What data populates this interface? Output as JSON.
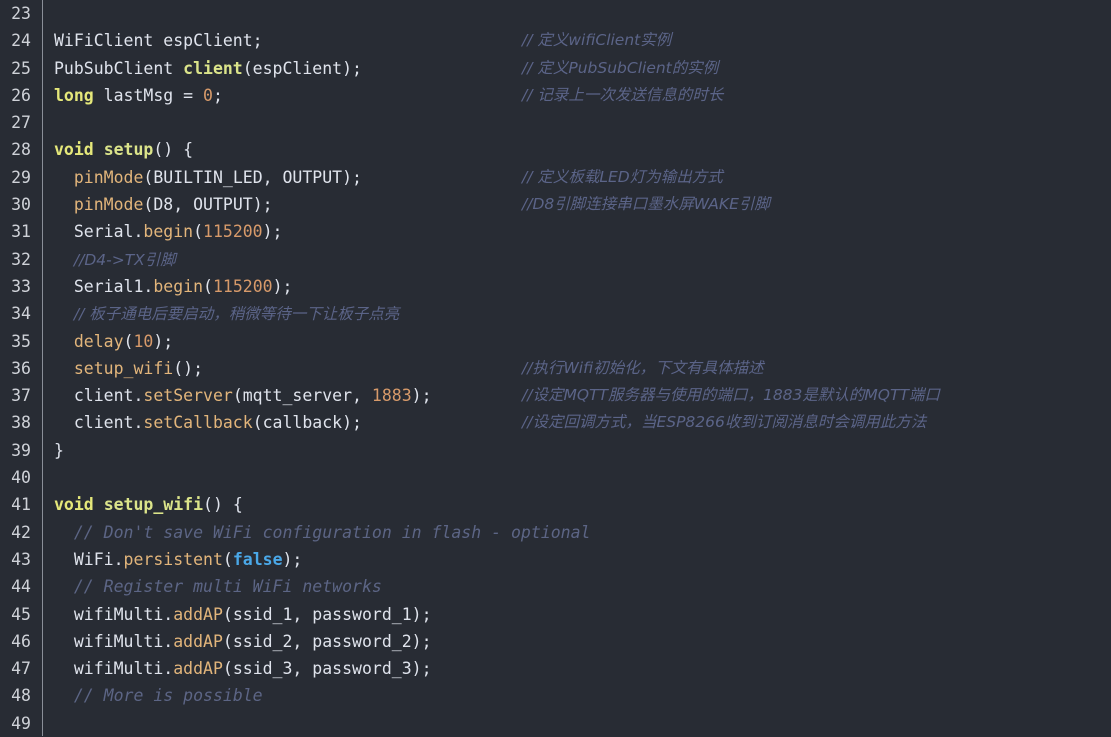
{
  "editor": {
    "theme_name": "one-dark",
    "language": "arduino-cpp",
    "colors": {
      "background": "#282c34",
      "gutter_text": "#cfd2d8",
      "gutter_rule": "#8a8f98",
      "foreground": "#dfe3ec",
      "keyword": "#e5e87a",
      "function": "#dbe48a",
      "method": "#e2b57b",
      "number": "#d79a6a",
      "boolean": "#4aa8e8",
      "comment": "#5c6585"
    },
    "first_line": 23,
    "last_line": 49
  },
  "lines": [
    {
      "no": "23",
      "code": [],
      "tail": null
    },
    {
      "no": "24",
      "code": [
        {
          "cls": "t-plain",
          "text": "WiFiClient espClient;"
        }
      ],
      "tail": {
        "cls": "comment-cn",
        "text": "// 定义wifiClient实例"
      }
    },
    {
      "no": "25",
      "code": [
        {
          "cls": "t-plain",
          "text": "PubSubClient "
        },
        {
          "cls": "t-fnname",
          "text": "client"
        },
        {
          "cls": "t-plain",
          "text": "(espClient);"
        }
      ],
      "tail": {
        "cls": "comment-cn",
        "text": "// 定义PubSubClient的实例"
      }
    },
    {
      "no": "26",
      "code": [
        {
          "cls": "t-kw",
          "text": "long"
        },
        {
          "cls": "t-plain",
          "text": " lastMsg = "
        },
        {
          "cls": "t-num",
          "text": "0"
        },
        {
          "cls": "t-plain",
          "text": ";"
        }
      ],
      "tail": {
        "cls": "comment-cn",
        "text": "// 记录上一次发送信息的时长"
      }
    },
    {
      "no": "27",
      "code": [],
      "tail": null
    },
    {
      "no": "28",
      "code": [
        {
          "cls": "t-kw",
          "text": "void"
        },
        {
          "cls": "t-plain",
          "text": " "
        },
        {
          "cls": "t-fnname",
          "text": "setup"
        },
        {
          "cls": "t-plain",
          "text": "() {"
        }
      ],
      "tail": null
    },
    {
      "no": "29",
      "code": [
        {
          "cls": "t-plain",
          "text": "  "
        },
        {
          "cls": "t-method",
          "text": "pinMode"
        },
        {
          "cls": "t-plain",
          "text": "(BUILTIN_LED, OUTPUT);"
        }
      ],
      "tail": {
        "cls": "comment-cn",
        "text": "// 定义板载LED灯为输出方式"
      }
    },
    {
      "no": "30",
      "code": [
        {
          "cls": "t-plain",
          "text": "  "
        },
        {
          "cls": "t-method",
          "text": "pinMode"
        },
        {
          "cls": "t-plain",
          "text": "(D8, OUTPUT);"
        }
      ],
      "tail": {
        "cls": "comment-cn",
        "text": "//D8引脚连接串口墨水屏WAKE引脚"
      }
    },
    {
      "no": "31",
      "code": [
        {
          "cls": "t-plain",
          "text": "  Serial."
        },
        {
          "cls": "t-method",
          "text": "begin"
        },
        {
          "cls": "t-plain",
          "text": "("
        },
        {
          "cls": "t-num",
          "text": "115200"
        },
        {
          "cls": "t-plain",
          "text": ");"
        }
      ],
      "tail": null
    },
    {
      "no": "32",
      "code": [
        {
          "cls": "t-plain",
          "text": "  "
        },
        {
          "cls": "comment-cn",
          "text": "//D4->TX引脚"
        }
      ],
      "tail": null
    },
    {
      "no": "33",
      "code": [
        {
          "cls": "t-plain",
          "text": "  Serial1."
        },
        {
          "cls": "t-method",
          "text": "begin"
        },
        {
          "cls": "t-plain",
          "text": "("
        },
        {
          "cls": "t-num",
          "text": "115200"
        },
        {
          "cls": "t-plain",
          "text": ");"
        }
      ],
      "tail": null
    },
    {
      "no": "34",
      "code": [
        {
          "cls": "t-plain",
          "text": "  "
        },
        {
          "cls": "comment-cn",
          "text": "// 板子通电后要启动，稍微等待一下让板子点亮"
        }
      ],
      "tail": null
    },
    {
      "no": "35",
      "code": [
        {
          "cls": "t-plain",
          "text": "  "
        },
        {
          "cls": "t-method",
          "text": "delay"
        },
        {
          "cls": "t-plain",
          "text": "("
        },
        {
          "cls": "t-num",
          "text": "10"
        },
        {
          "cls": "t-plain",
          "text": ");"
        }
      ],
      "tail": null
    },
    {
      "no": "36",
      "code": [
        {
          "cls": "t-plain",
          "text": "  "
        },
        {
          "cls": "t-method",
          "text": "setup_wifi"
        },
        {
          "cls": "t-plain",
          "text": "();"
        }
      ],
      "tail": {
        "cls": "comment-cn",
        "text": "//执行Wifi初始化，下文有具体描述"
      }
    },
    {
      "no": "37",
      "code": [
        {
          "cls": "t-plain",
          "text": "  client."
        },
        {
          "cls": "t-method",
          "text": "setServer"
        },
        {
          "cls": "t-plain",
          "text": "(mqtt_server, "
        },
        {
          "cls": "t-num",
          "text": "1883"
        },
        {
          "cls": "t-plain",
          "text": ");"
        }
      ],
      "tail": {
        "cls": "comment-cn",
        "text": "//设定MQTT服务器与使用的端口，1883是默认的MQTT端口"
      }
    },
    {
      "no": "38",
      "code": [
        {
          "cls": "t-plain",
          "text": "  client."
        },
        {
          "cls": "t-method",
          "text": "setCallback"
        },
        {
          "cls": "t-plain",
          "text": "(callback);"
        }
      ],
      "tail": {
        "cls": "comment-cn",
        "text": "//设定回调方式，当ESP8266收到订阅消息时会调用此方法"
      }
    },
    {
      "no": "39",
      "code": [
        {
          "cls": "t-plain",
          "text": "}"
        }
      ],
      "tail": null
    },
    {
      "no": "40",
      "code": [],
      "tail": null
    },
    {
      "no": "41",
      "code": [
        {
          "cls": "t-kw",
          "text": "void"
        },
        {
          "cls": "t-plain",
          "text": " "
        },
        {
          "cls": "t-fnname",
          "text": "setup_wifi"
        },
        {
          "cls": "t-plain",
          "text": "() {"
        }
      ],
      "tail": null
    },
    {
      "no": "42",
      "code": [
        {
          "cls": "t-plain",
          "text": "  "
        },
        {
          "cls": "comment",
          "text": "// Don't save WiFi configuration in flash - optional"
        }
      ],
      "tail": null
    },
    {
      "no": "43",
      "code": [
        {
          "cls": "t-plain",
          "text": "  WiFi."
        },
        {
          "cls": "t-method",
          "text": "persistent"
        },
        {
          "cls": "t-plain",
          "text": "("
        },
        {
          "cls": "t-bool",
          "text": "false"
        },
        {
          "cls": "t-plain",
          "text": ");"
        }
      ],
      "tail": null
    },
    {
      "no": "44",
      "code": [
        {
          "cls": "t-plain",
          "text": "  "
        },
        {
          "cls": "comment",
          "text": "// Register multi WiFi networks"
        }
      ],
      "tail": null
    },
    {
      "no": "45",
      "code": [
        {
          "cls": "t-plain",
          "text": "  wifiMulti."
        },
        {
          "cls": "t-method",
          "text": "addAP"
        },
        {
          "cls": "t-plain",
          "text": "(ssid_1, password_1);"
        }
      ],
      "tail": null
    },
    {
      "no": "46",
      "code": [
        {
          "cls": "t-plain",
          "text": "  wifiMulti."
        },
        {
          "cls": "t-method",
          "text": "addAP"
        },
        {
          "cls": "t-plain",
          "text": "(ssid_2, password_2);"
        }
      ],
      "tail": null
    },
    {
      "no": "47",
      "code": [
        {
          "cls": "t-plain",
          "text": "  wifiMulti."
        },
        {
          "cls": "t-method",
          "text": "addAP"
        },
        {
          "cls": "t-plain",
          "text": "(ssid_3, password_3);"
        }
      ],
      "tail": null
    },
    {
      "no": "48",
      "code": [
        {
          "cls": "t-plain",
          "text": "  "
        },
        {
          "cls": "comment",
          "text": "// More is possible"
        }
      ],
      "tail": null
    },
    {
      "no": "49",
      "code": [],
      "tail": null
    }
  ]
}
